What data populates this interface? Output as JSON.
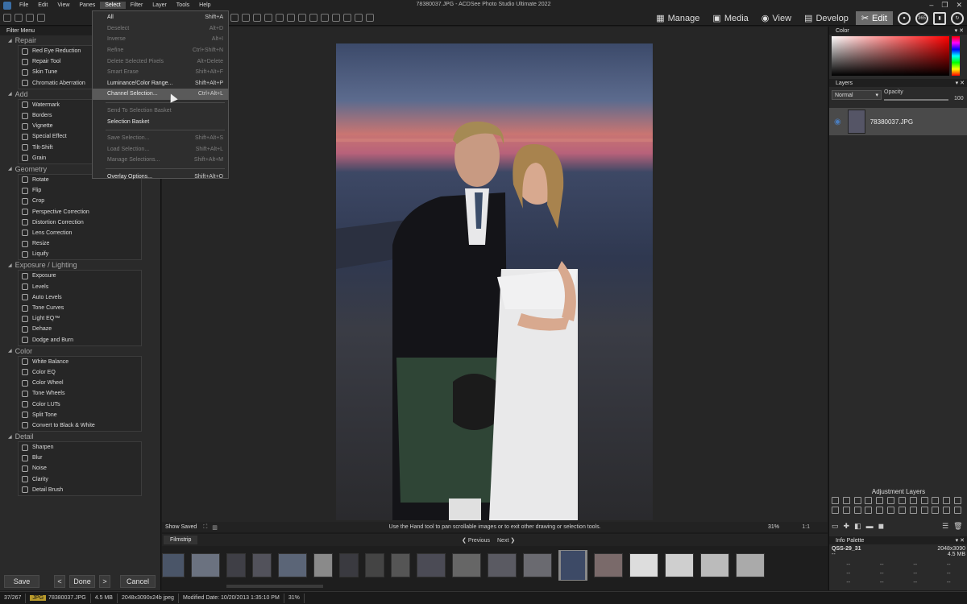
{
  "app": {
    "title": "78380037.JPG - ACDSee Photo Studio Ultimate 2022",
    "menu": [
      "File",
      "Edit",
      "View",
      "Panes",
      "Select",
      "Filter",
      "Layer",
      "Tools",
      "Help"
    ],
    "active_menu": "Select"
  },
  "modes": [
    {
      "label": "Manage",
      "icon": "grid-icon"
    },
    {
      "label": "Media",
      "icon": "media-icon"
    },
    {
      "label": "View",
      "icon": "eye-icon"
    },
    {
      "label": "Develop",
      "icon": "develop-icon"
    },
    {
      "label": "Edit",
      "icon": "edit-icon",
      "active": true
    }
  ],
  "select_menu": {
    "items": [
      {
        "label": "All",
        "shortcut": "Shift+A",
        "enabled": true
      },
      {
        "label": "Deselect",
        "shortcut": "Alt+D",
        "enabled": false
      },
      {
        "label": "Inverse",
        "shortcut": "Alt+I",
        "enabled": false
      },
      {
        "label": "Refine",
        "shortcut": "Ctrl+Shift+N",
        "enabled": false
      },
      {
        "label": "Delete Selected Pixels",
        "shortcut": "Alt+Delete",
        "enabled": false
      },
      {
        "label": "Smart Erase",
        "shortcut": "Shift+Alt+F",
        "enabled": false
      },
      {
        "label": "Luminance/Color Range...",
        "shortcut": "Shift+Alt+P",
        "enabled": true
      },
      {
        "label": "Channel Selection...",
        "shortcut": "Ctrl+Alt+L",
        "enabled": true,
        "highlighted": true
      },
      {
        "separator": true
      },
      {
        "label": "Send To Selection Basket",
        "shortcut": "",
        "enabled": false
      },
      {
        "label": "Selection Basket",
        "shortcut": "",
        "enabled": true
      },
      {
        "separator": true
      },
      {
        "label": "Save Selection...",
        "shortcut": "Shift+Alt+S",
        "enabled": false
      },
      {
        "label": "Load Selection...",
        "shortcut": "Shift+Alt+L",
        "enabled": false
      },
      {
        "label": "Manage Selections...",
        "shortcut": "Shift+Alt+M",
        "enabled": false
      },
      {
        "separator": true
      },
      {
        "label": "Overlay Options...",
        "shortcut": "Shift+Alt+O",
        "enabled": true
      }
    ]
  },
  "filter_menu": {
    "title": "Filter Menu",
    "groups": [
      {
        "title": "Repair",
        "items": [
          "Red Eye Reduction",
          "Repair Tool",
          "Skin Tune",
          "Chromatic Aberration"
        ]
      },
      {
        "title": "Add",
        "items": [
          "Watermark",
          "Borders",
          "Vignette",
          "Special Effect",
          "Tilt-Shift",
          "Grain"
        ]
      },
      {
        "title": "Geometry",
        "items": [
          "Rotate",
          "Flip",
          "Crop",
          "Perspective Correction",
          "Distortion Correction",
          "Lens Correction",
          "Resize",
          "Liquify"
        ]
      },
      {
        "title": "Exposure / Lighting",
        "items": [
          "Exposure",
          "Levels",
          "Auto Levels",
          "Tone Curves",
          "Light EQ™",
          "Dehaze",
          "Dodge and Burn"
        ]
      },
      {
        "title": "Color",
        "items": [
          "White Balance",
          "Color EQ",
          "Color Wheel",
          "Tone Wheels",
          "Color LUTs",
          "Split Tone",
          "Convert to Black & White"
        ]
      },
      {
        "title": "Detail",
        "items": [
          "Sharpen",
          "Blur",
          "Noise",
          "Clarity",
          "Detail Brush"
        ]
      }
    ],
    "buttons": {
      "save": "Save",
      "done": "Done",
      "cancel": "Cancel"
    }
  },
  "view": {
    "show_saved": "Show Saved",
    "hint": "Use the Hand tool to pan scrollable images or to exit other drawing or selection tools.",
    "zoom": "31%",
    "ratio": "1:1"
  },
  "filmstrip": {
    "tab": "Filmstrip",
    "previous": "Previous",
    "next": "Next",
    "thumbs": [
      28,
      36,
      24,
      24,
      36,
      24,
      24,
      24,
      24,
      36,
      36,
      36,
      36,
      36,
      36,
      36,
      36,
      36,
      36
    ],
    "selected_index": 13
  },
  "color_panel": {
    "title": "Color"
  },
  "layers": {
    "title": "Layers",
    "blend_mode": "Normal",
    "opacity_label": "Opacity",
    "opacity_value": "100",
    "layer_name": "78380037.JPG"
  },
  "adjustment_layers": {
    "title": "Adjustment Layers"
  },
  "info_palette": {
    "title": "Info Palette",
    "camera": "QSS-29_31",
    "dimensions": "2048x3090",
    "size": "4.5 MB",
    "placeholder": "--"
  },
  "statusbar": {
    "count": "37/267",
    "type": "JPG",
    "filename": "78380037.JPG",
    "filesize": "4.5 MB",
    "dimensions": "2048x3090x24b jpeg",
    "modified": "Modified Date: 10/20/2013 1:35:10 PM",
    "zoom": "31%"
  }
}
